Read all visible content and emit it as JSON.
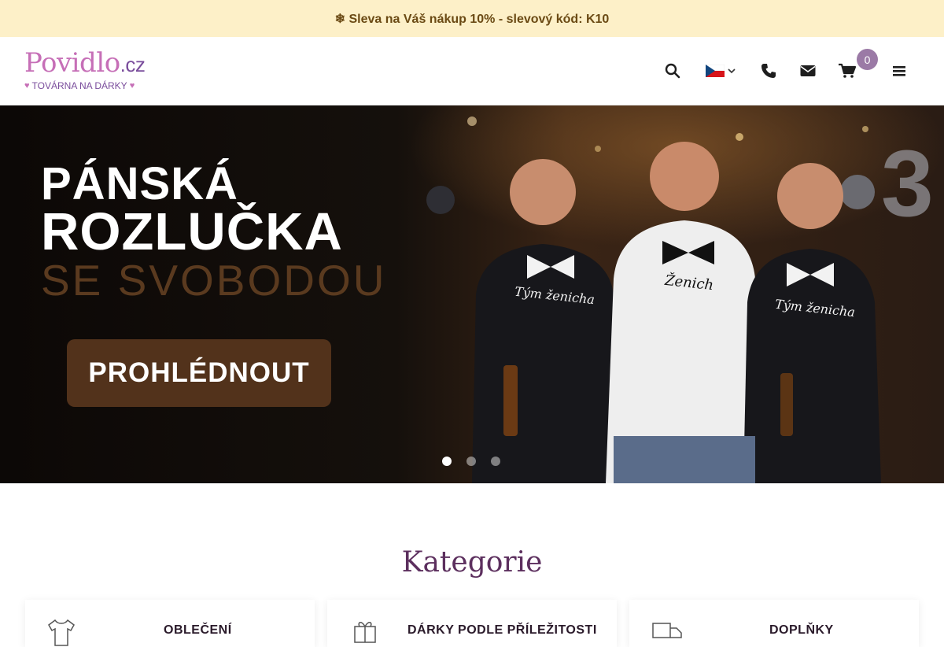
{
  "promo": {
    "text": "❄ Sleva na Váš nákup 10% - slevový kód: K10"
  },
  "header": {
    "logo_text": "Povidlo",
    "logo_tld": ".cz",
    "logo_sub": "TOVÁRNA NA DÁRKY",
    "cart_count": "0",
    "icons": [
      "search-icon",
      "flag-cz-icon",
      "phone-icon",
      "envelope-icon",
      "cart-icon",
      "hamburger-icon"
    ]
  },
  "hero": {
    "line1": "PÁNSKÁ",
    "line2": "ROZLUČKA",
    "line3": "SE SVOBODOU",
    "cta": "PROHLÉDNOUT",
    "shirt_text_left": "Tým ženicha",
    "shirt_text_center": "Ženich",
    "shirt_text_right": "Tým ženicha",
    "slides": 3,
    "active_slide": 1
  },
  "categories": {
    "title": "Kategorie",
    "items": [
      {
        "label": "OBLEČENÍ",
        "icon": "tshirt-icon"
      },
      {
        "label": "DÁRKY PODLE PŘÍLEŽITOSTI",
        "icon": "gift-icon"
      },
      {
        "label": "DOPLŇKY",
        "icon": "truck-icon"
      }
    ]
  },
  "colors": {
    "accent": "#9b7aa6",
    "promo_bg": "#fdf0c8",
    "cta": "#52321b",
    "title": "#5c2f5e"
  }
}
